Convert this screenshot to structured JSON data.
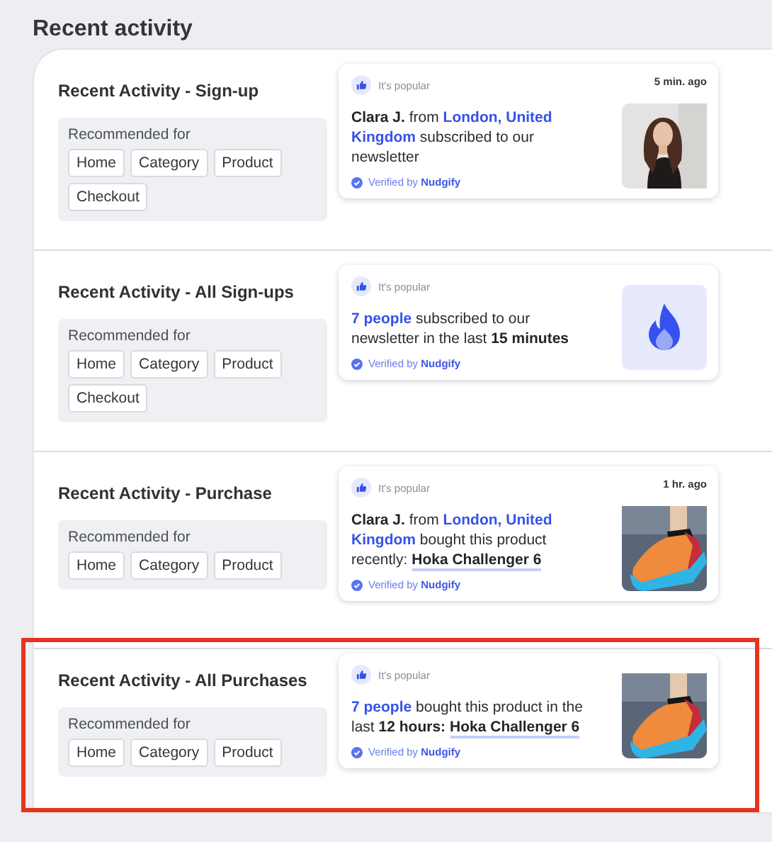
{
  "heading": "Recent activity",
  "rows": [
    {
      "title": "Recent Activity - Sign-up",
      "selected": false,
      "recommended_label": "Recommended for",
      "tags": [
        "Home",
        "Category",
        "Product",
        "Checkout"
      ],
      "card": {
        "badge": "It's popular",
        "time": "5 min. ago",
        "message": [
          {
            "text": "Clara J.",
            "kind": "strong"
          },
          {
            "text": " from ",
            "kind": "plain"
          },
          {
            "text": "London, United Kingdom",
            "kind": "highlight"
          },
          {
            "text": " subscribed to our newsletter",
            "kind": "plain"
          }
        ],
        "verified": "Verified by",
        "brand": "Nudgify",
        "media": {
          "kind": "person"
        }
      }
    },
    {
      "title": "Recent Activity - All Sign-ups",
      "selected": false,
      "recommended_label": "Recommended for",
      "tags": [
        "Home",
        "Category",
        "Product",
        "Checkout"
      ],
      "card": {
        "badge": "It's popular",
        "message": [
          {
            "text": "7 people",
            "kind": "highlight"
          },
          {
            "text": " subscribed to our newsletter in the last ",
            "kind": "plain"
          },
          {
            "text": "15 minutes",
            "kind": "strong"
          }
        ],
        "verified": "Verified by",
        "brand": "Nudgify",
        "media": {
          "kind": "fire"
        }
      }
    },
    {
      "title": "Recent Activity - Purchase",
      "selected": false,
      "recommended_label": "Recommended for",
      "tags": [
        "Home",
        "Category",
        "Product"
      ],
      "card": {
        "badge": "It's popular",
        "time": "1 hr. ago",
        "message": [
          {
            "text": "Clara J.",
            "kind": "strong"
          },
          {
            "text": " from ",
            "kind": "plain"
          },
          {
            "text": "London, United Kingdom",
            "kind": "highlight"
          },
          {
            "text": " bought this product recently: ",
            "kind": "plain"
          },
          {
            "text": "Hoka Challenger 6",
            "kind": "link"
          }
        ],
        "verified": "Verified by",
        "brand": "Nudgify",
        "media": {
          "kind": "shoe"
        }
      }
    },
    {
      "title": "Recent Activity - All Purchases",
      "selected": true,
      "recommended_label": "Recommended for",
      "tags": [
        "Home",
        "Category",
        "Product"
      ],
      "card": {
        "badge": "It's popular",
        "message": [
          {
            "text": "7 people",
            "kind": "highlight"
          },
          {
            "text": " bought this product in the last ",
            "kind": "plain"
          },
          {
            "text": "12 hours:",
            "kind": "strong"
          },
          {
            "text": "Hoka Challenger 6",
            "kind": "link"
          }
        ],
        "verified": "Verified by",
        "brand": "Nudgify",
        "media": {
          "kind": "shoe"
        }
      }
    }
  ]
}
